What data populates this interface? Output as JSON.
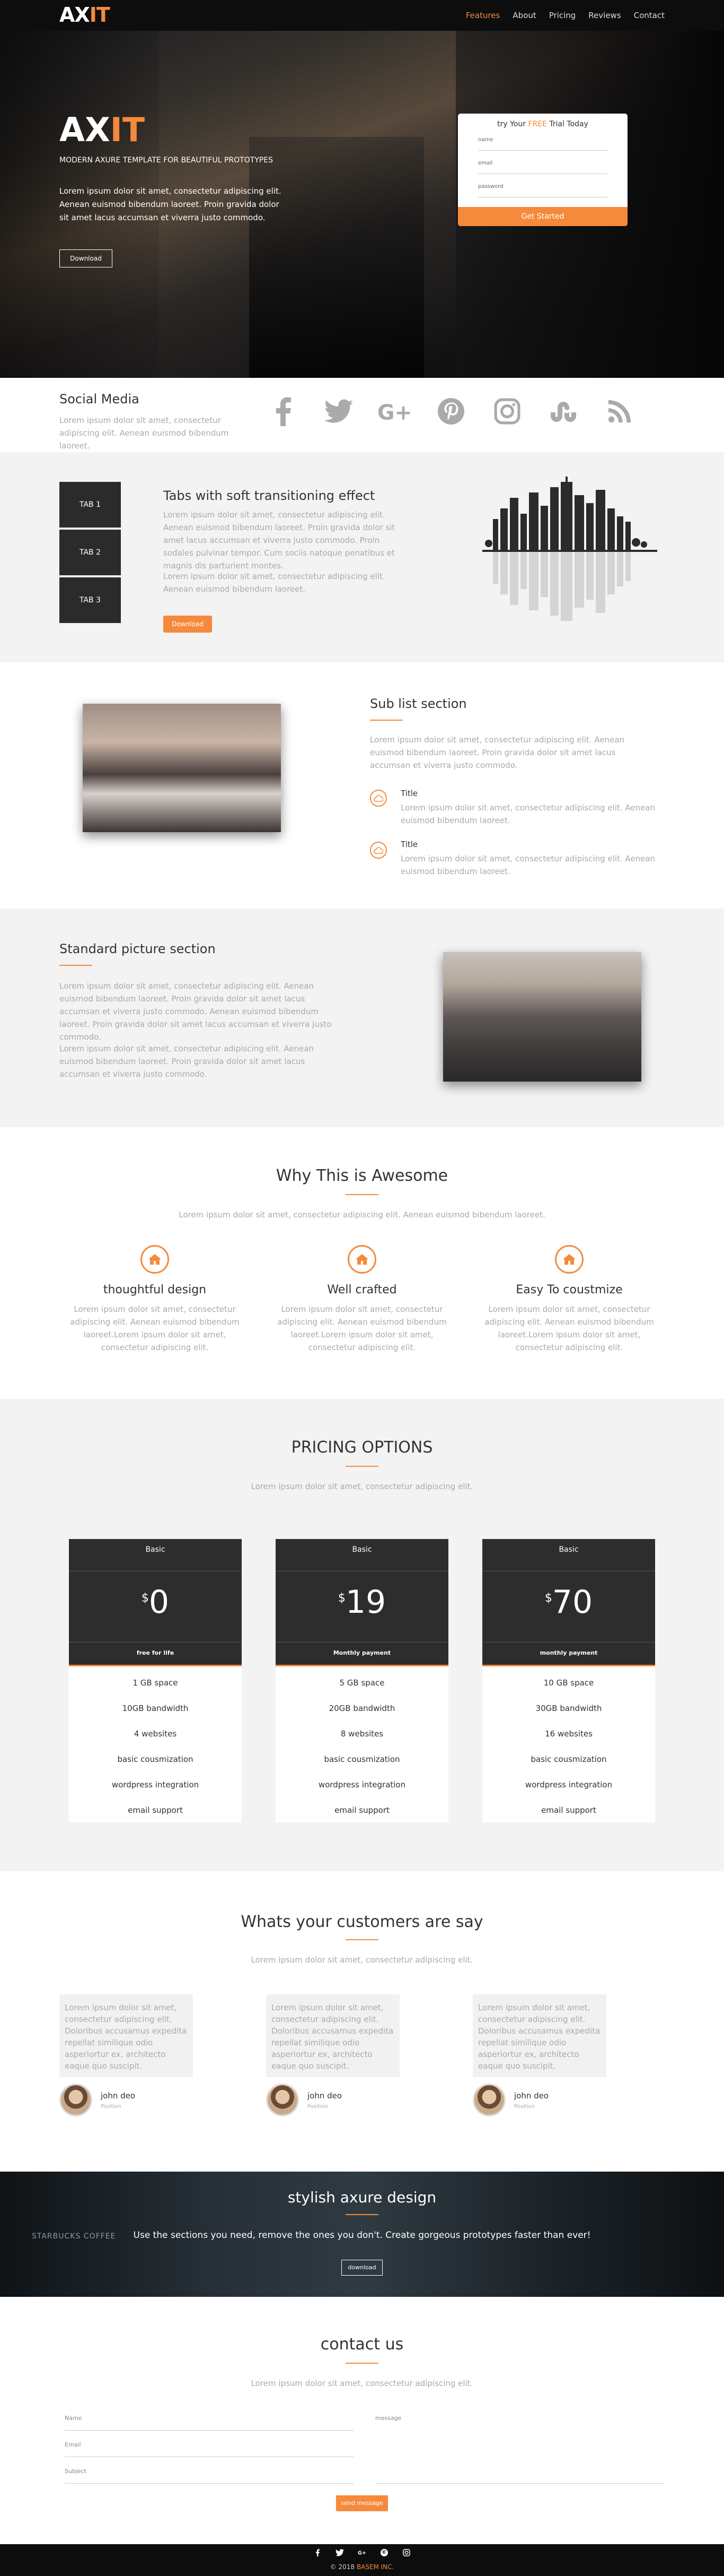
{
  "nav": {
    "logo_a": "AX",
    "logo_b": "IT",
    "links": [
      "Features",
      "About",
      "Pricing",
      "Reviews",
      "Contact"
    ]
  },
  "hero": {
    "title_a": "AX",
    "title_b": "IT",
    "subtitle": "MODERN AXURE TEMPLATE FOR BEAUTIFUL PROTOTYPES",
    "paragraph": "Lorem ipsum dolor sit amet, consectetur adipiscing elit. Aenean euismod bibendum laoreet. Proin gravida dolor sit amet lacus accumsan et viverra justo commodo.",
    "button": "Download",
    "form": {
      "title_a": "try Your ",
      "title_hl": "FREE",
      "title_b": " Trial Today",
      "name_label": "name",
      "email_label": "email",
      "password_label": "password",
      "submit": "Get Started"
    }
  },
  "social": {
    "heading": "Social Media",
    "text": "Lorem ipsum dolor sit amet, consectetur adipiscing elit. Aenean euismod bibendum laoreet.",
    "icons": [
      "facebook-icon",
      "twitter-icon",
      "google-plus-icon",
      "pinterest-icon",
      "instagram-icon",
      "stumbleupon-icon",
      "rss-icon"
    ]
  },
  "tabs": {
    "items": [
      "TAB 1",
      "TAB 2",
      "TAB 3"
    ],
    "heading": "Tabs with soft transitioning effect",
    "para1": "Lorem ipsum dolor sit amet, consectetur adipiscing elit. Aenean euismod bibendum laoreet. Proin gravida dolor sit amet lacus accumsan et viverra justo commodo. Proin sodales pulvinar tempor. Cum sociis natoque penatibus et magnis dis parturient montes.",
    "para2": "Lorem ipsum dolor sit amet, consectetur adipiscing elit. Aenean euismod bibendum laoreet.",
    "button": "Download"
  },
  "sublist": {
    "heading": "Sub list section",
    "intro": "Lorem ipsum dolor sit amet, consectetur adipiscing elit. Aenean euismod bibendum laoreet. Proin gravida dolor sit amet lacus accumsan et viverra justo commodo.",
    "items": [
      {
        "title": "Title",
        "text": "Lorem ipsum dolor sit amet, consectetur adipiscing elit. Aenean euismod bibendum laoreet."
      },
      {
        "title": "Title",
        "text": "Lorem ipsum dolor sit amet, consectetur adipiscing elit. Aenean euismod bibendum laoreet."
      }
    ]
  },
  "standard": {
    "heading": "Standard picture section",
    "para1": "Lorem ipsum dolor sit amet, consectetur adipiscing elit. Aenean euismod bibendum laoreet. Proin gravida dolor sit amet lacus accumsan et viverra justo commodo. Aenean euismod bibendum laoreet. Proin gravida dolor sit amet lacus accumsan et viverra justo commodo.",
    "para2": "Lorem ipsum dolor sit amet, consectetur adipiscing elit. Aenean euismod bibendum laoreet. Proin gravida dolor sit amet lacus accumsan et viverra justo commodo."
  },
  "why": {
    "heading": "Why This is Awesome",
    "sub": "Lorem ipsum dolor sit amet, consectetur adipiscing elit. Aenean euismod bibendum laoreet.",
    "features": [
      {
        "title": "thoughtful design",
        "text": "Lorem ipsum dolor sit amet, consectetur adipiscing elit. Aenean euismod bibendum laoreet.Lorem ipsum dolor sit amet, consectetur adipiscing elit."
      },
      {
        "title": "Well crafted",
        "text": "Lorem ipsum dolor sit amet, consectetur adipiscing elit. Aenean euismod bibendum laoreet.Lorem ipsum dolor sit amet, consectetur adipiscing elit."
      },
      {
        "title": "Easy To coustmize",
        "text": "Lorem ipsum dolor sit amet, consectetur adipiscing elit. Aenean euismod bibendum laoreet.Lorem ipsum dolor sit amet, consectetur adipiscing elit."
      }
    ]
  },
  "pricing": {
    "heading": "PRICING OPTIONS",
    "sub": "Lorem ipsum dolor sit amet, consectetur adipiscing elit.",
    "plans": [
      {
        "name": "Basic",
        "currency": "$",
        "price": "0",
        "plan": "free for life",
        "features": [
          "1 GB space",
          "10GB bandwidth",
          "4 websites",
          "basic cousmization",
          "wordpress integration",
          "email support"
        ]
      },
      {
        "name": "Basic",
        "currency": "$",
        "price": "19",
        "plan": "Monthly payment",
        "features": [
          "5 GB space",
          "20GB bandwidth",
          "8 websites",
          "basic cousmization",
          "wordpress integration",
          "email support"
        ]
      },
      {
        "name": "Basic",
        "currency": "$",
        "price": "70",
        "plan": "monthly payment",
        "features": [
          "10 GB space",
          "30GB bandwidth",
          "16 websites",
          "basic cousmization",
          "wordpress integration",
          "email support"
        ]
      }
    ]
  },
  "testimonials": {
    "heading": "Whats your customers are say",
    "sub": "Lorem ipsum dolor sit amet, consectetur adipiscing elit.",
    "items": [
      {
        "quote": "Lorem ipsum dolor sit amet, consectetur adipiscing elit. Doloribus accusamus expedita repellat similique odio asperiortur ex, architecto eaque quo suscipit.",
        "name": "john deo",
        "position": "Position"
      },
      {
        "quote": "Lorem ipsum dolor sit amet, consectetur adipiscing elit. Doloribus accusamus expedita repellat similique odio asperiortur ex, architecto eaque quo suscipit.",
        "name": "john deo",
        "position": "Position"
      },
      {
        "quote": "Lorem ipsum dolor sit amet, consectetur adipiscing elit. Doloribus accusamus expedita repellat similique odio asperiortur ex, architecto eaque quo suscipit.",
        "name": "john deo",
        "position": "Position"
      }
    ]
  },
  "cta": {
    "heading": "stylish axure design",
    "text": "Use the sections you need, remove the ones you don't. Create gorgeous prototypes faster than ever!",
    "button": "download",
    "sign": "STARBUCKS COFFEE"
  },
  "contact": {
    "heading": "contact us",
    "sub": "Lorem ipsum dolor sit amet, consectetur adipiscing elit.",
    "name_label": "Name",
    "email_label": "Email",
    "subject_label": "Subject",
    "message_label": "message",
    "button": "send message"
  },
  "footer": {
    "icons": [
      "facebook-icon",
      "twitter-icon",
      "google-plus-icon",
      "pinterest-icon",
      "instagram-icon"
    ],
    "copy_a": "© 2018 ",
    "copy_b": "BASEM",
    "copy_c": " INC."
  },
  "colors": {
    "accent": "#f58a3c",
    "dark": "#2b2b2b",
    "light_bg": "#f3f3f3"
  }
}
